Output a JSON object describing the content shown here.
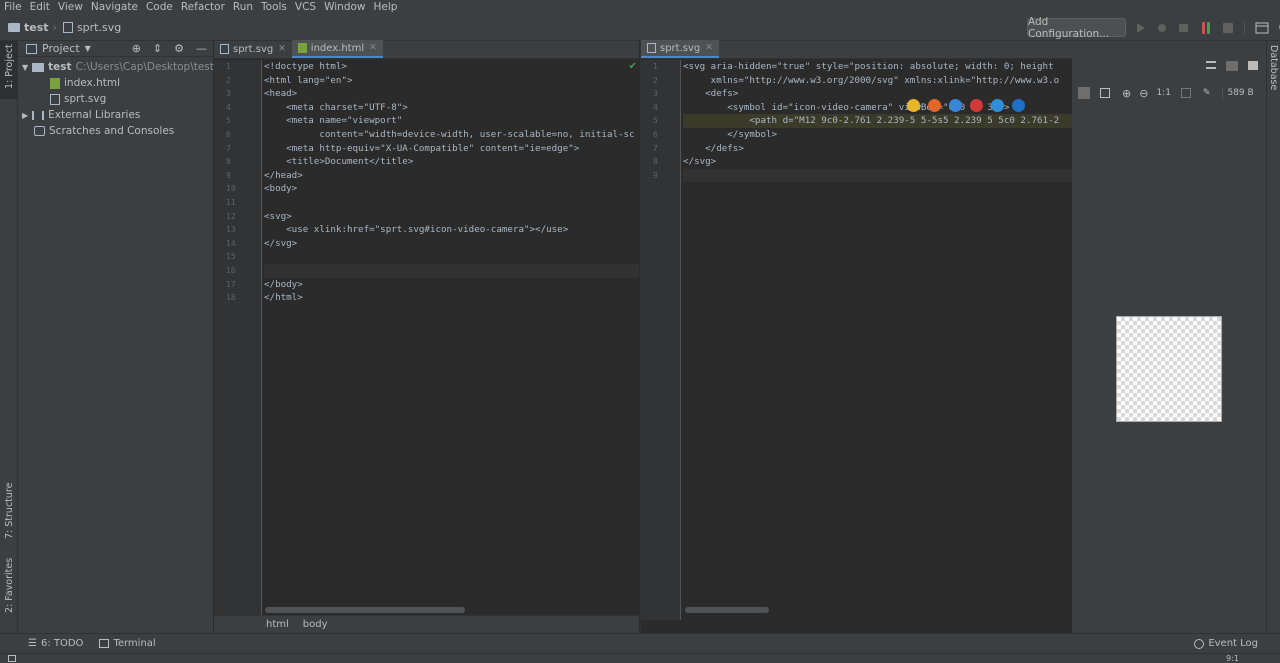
{
  "menu": [
    "File",
    "Edit",
    "View",
    "Navigate",
    "Code",
    "Refactor",
    "Run",
    "Tools",
    "VCS",
    "Window",
    "Help"
  ],
  "breadcrumb": {
    "project": "test",
    "file": "sprt.svg"
  },
  "toolbar": {
    "add_config": "Add Configuration..."
  },
  "left_strip": {
    "project_tab": "1: Project",
    "structure_tab": "7: Structure",
    "favorites_tab": "2: Favorites"
  },
  "right_strip": {
    "database_tab": "Database"
  },
  "project_panel": {
    "title": "Project",
    "tree": [
      {
        "label": "test",
        "path": "C:\\Users\\Cap\\Desktop\\test"
      },
      {
        "label": "index.html"
      },
      {
        "label": "sprt.svg"
      },
      {
        "label": "External Libraries"
      },
      {
        "label": "Scratches and Consoles"
      }
    ]
  },
  "editor1": {
    "tabs": [
      {
        "label": "sprt.svg"
      },
      {
        "label": "index.html"
      }
    ],
    "line_numbers": [
      "1",
      "2",
      "3",
      "4",
      "5",
      "6",
      "7",
      "8",
      "9",
      "10",
      "11",
      "12",
      "13",
      "14",
      "15",
      "16",
      "17",
      "18"
    ],
    "lines": [
      "<!doctype html>",
      "<html lang=\"en\">",
      "<head>",
      "    <meta charset=\"UTF-8\">",
      "    <meta name=\"viewport\"",
      "          content=\"width=device-width, user-scalable=no, initial-sc",
      "    <meta http-equiv=\"X-UA-Compatible\" content=\"ie=edge\">",
      "    <title>Document</title>",
      "</head>",
      "<body>",
      "",
      "<svg>",
      "    <use xlink:href=\"sprt.svg#icon-video-camera\"></use>",
      "</svg>",
      "",
      "",
      "</body>",
      "</html>"
    ],
    "breadcrumb": [
      "html",
      "body"
    ]
  },
  "editor2": {
    "tabs": [
      {
        "label": "sprt.svg"
      }
    ],
    "line_numbers": [
      "1",
      "2",
      "3",
      "4",
      "5",
      "6",
      "7",
      "8",
      "9"
    ],
    "lines": [
      "<svg aria-hidden=\"true\" style=\"position: absolute; width: 0; height",
      "     xmlns=\"http://www.w3.org/2000/svg\" xmlns:xlink=\"http://www.w3.o",
      "    <defs>",
      "        <symbol id=\"icon-video-camera\" viewBox=\"0 0 32 32\">",
      "            <path d=\"M12 9c0-2.761 2.239-5 5-5s5 2.239 5 5c0 2.761-2",
      "        </symbol>",
      "    </defs>",
      "</svg>",
      ""
    ]
  },
  "preview": {
    "zoom_label": "1:1",
    "file_size": "589 B"
  },
  "bottombar": {
    "todo": "6: TODO",
    "terminal": "Terminal",
    "event_log": "Event Log"
  },
  "statusbar": {
    "position": "9:1"
  }
}
